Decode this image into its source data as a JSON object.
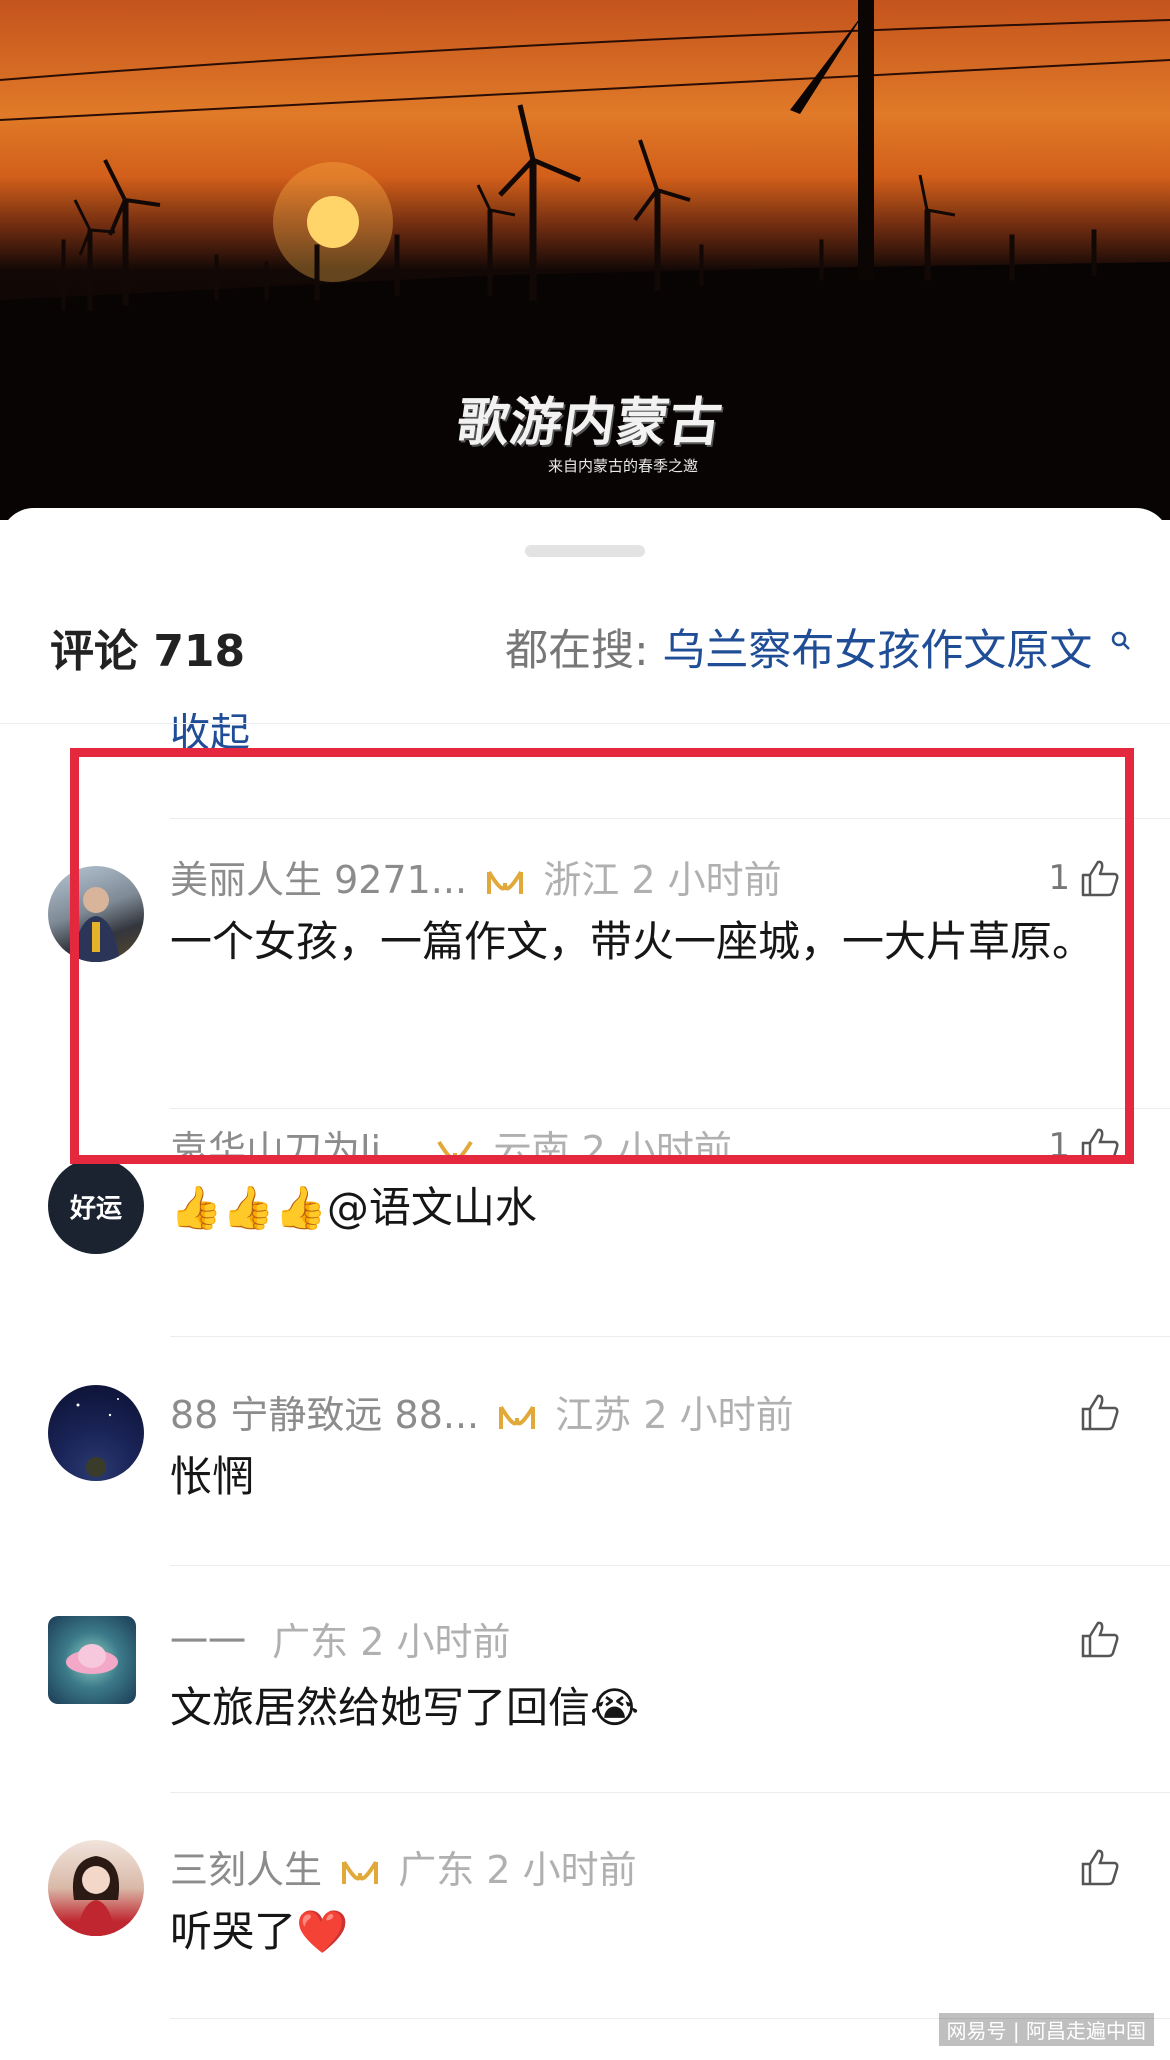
{
  "hero": {
    "title": "歌游内蒙古",
    "subtitle": "来自内蒙古的春季之邀"
  },
  "header": {
    "comment_count": "评论 718",
    "search_label": "都在搜:",
    "search_term": "乌兰察布女孩作文原文",
    "search_icon": "search-icon"
  },
  "collapse_label": "收起",
  "comments": [
    {
      "name": "美丽人生 9271...",
      "location": "浙江",
      "time": "2 小时前",
      "likes": "1",
      "text": "一个女孩，一篇作文，带火一座城，一大片草原。",
      "avatar": "portrait"
    },
    {
      "name": "袁华山刀为li...",
      "location": "云南",
      "time": "2 小时前",
      "likes": "1",
      "text": "👍👍👍@语文山水",
      "avatar_text": "好运"
    },
    {
      "name": "88 宁静致远 88...",
      "location": "江苏",
      "time": "2 小时前",
      "likes": "",
      "text": "怅惘",
      "avatar": "night-sky"
    },
    {
      "name": "一一",
      "location": "广东",
      "time": "2 小时前",
      "likes": "",
      "text": "文旅居然给她写了回信😭",
      "avatar": "lotus"
    },
    {
      "name": "三刻人生",
      "location": "广东",
      "time": "2 小时前",
      "likes": "",
      "text": "听哭了❤️",
      "avatar": "portrait-woman"
    }
  ],
  "watermark": "网易号 | 阿昌走遍中国",
  "colors": {
    "highlight": "#e4283d",
    "link": "#1f4d96",
    "vip_badge": "#e0a93a"
  }
}
